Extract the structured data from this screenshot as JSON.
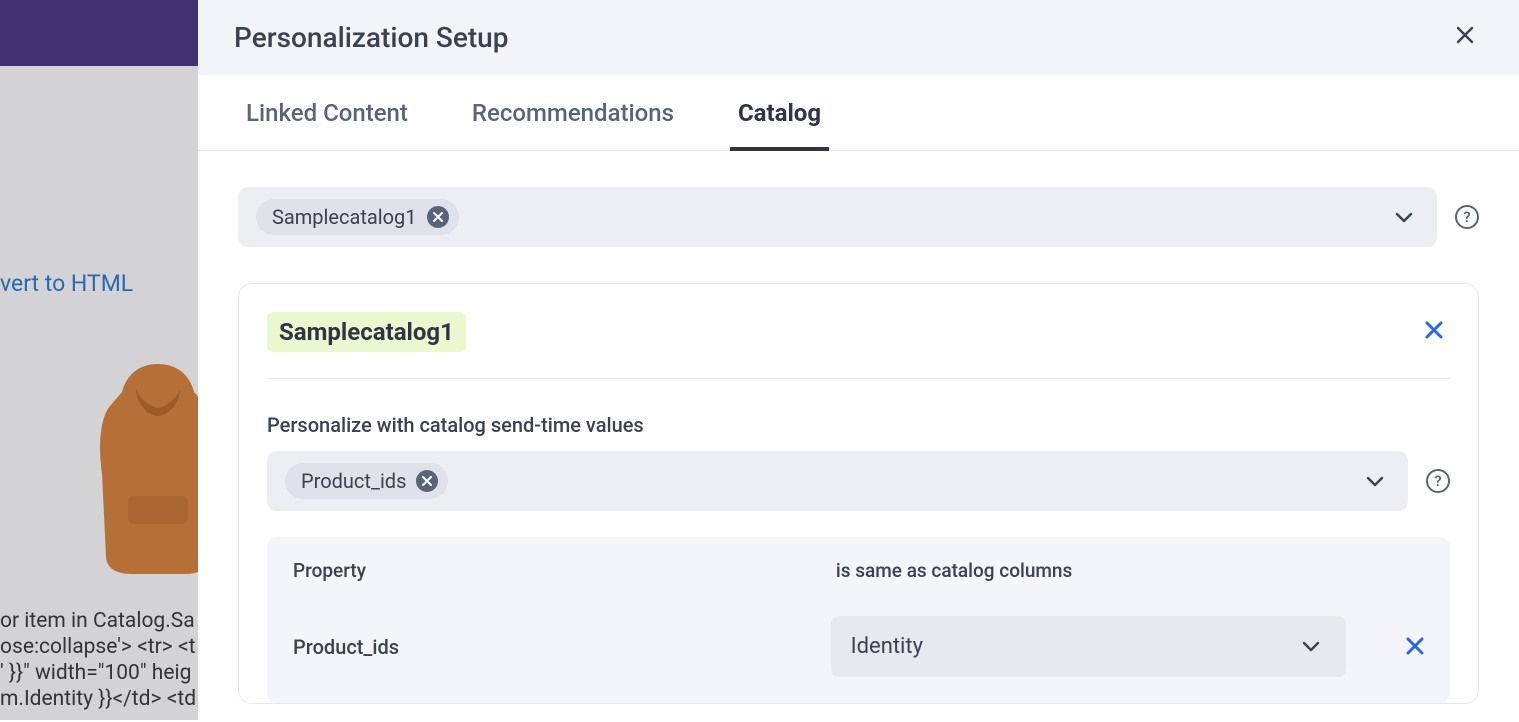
{
  "panel": {
    "title": "Personalization Setup"
  },
  "tabs": [
    {
      "label": "Linked Content",
      "active": false
    },
    {
      "label": "Recommendations",
      "active": false
    },
    {
      "label": "Catalog",
      "active": true
    }
  ],
  "catalog_select": {
    "chip_label": "Samplecatalog1"
  },
  "card": {
    "title": "Samplecatalog1",
    "section_label": "Personalize with catalog send-time values",
    "property_chip": "Product_ids",
    "mapping": {
      "header_property": "Property",
      "header_catalog": "is same as catalog columns",
      "rows": [
        {
          "property": "Product_ids",
          "catalog_column": "Identity"
        }
      ]
    }
  },
  "background": {
    "link_text": "vert to HTML",
    "code_preview": "or item in Catalog.Sa\nose:collapse'> <tr> <t\n' }}\" width=\"100\" heig\nm.Identity }}</td> <td"
  }
}
